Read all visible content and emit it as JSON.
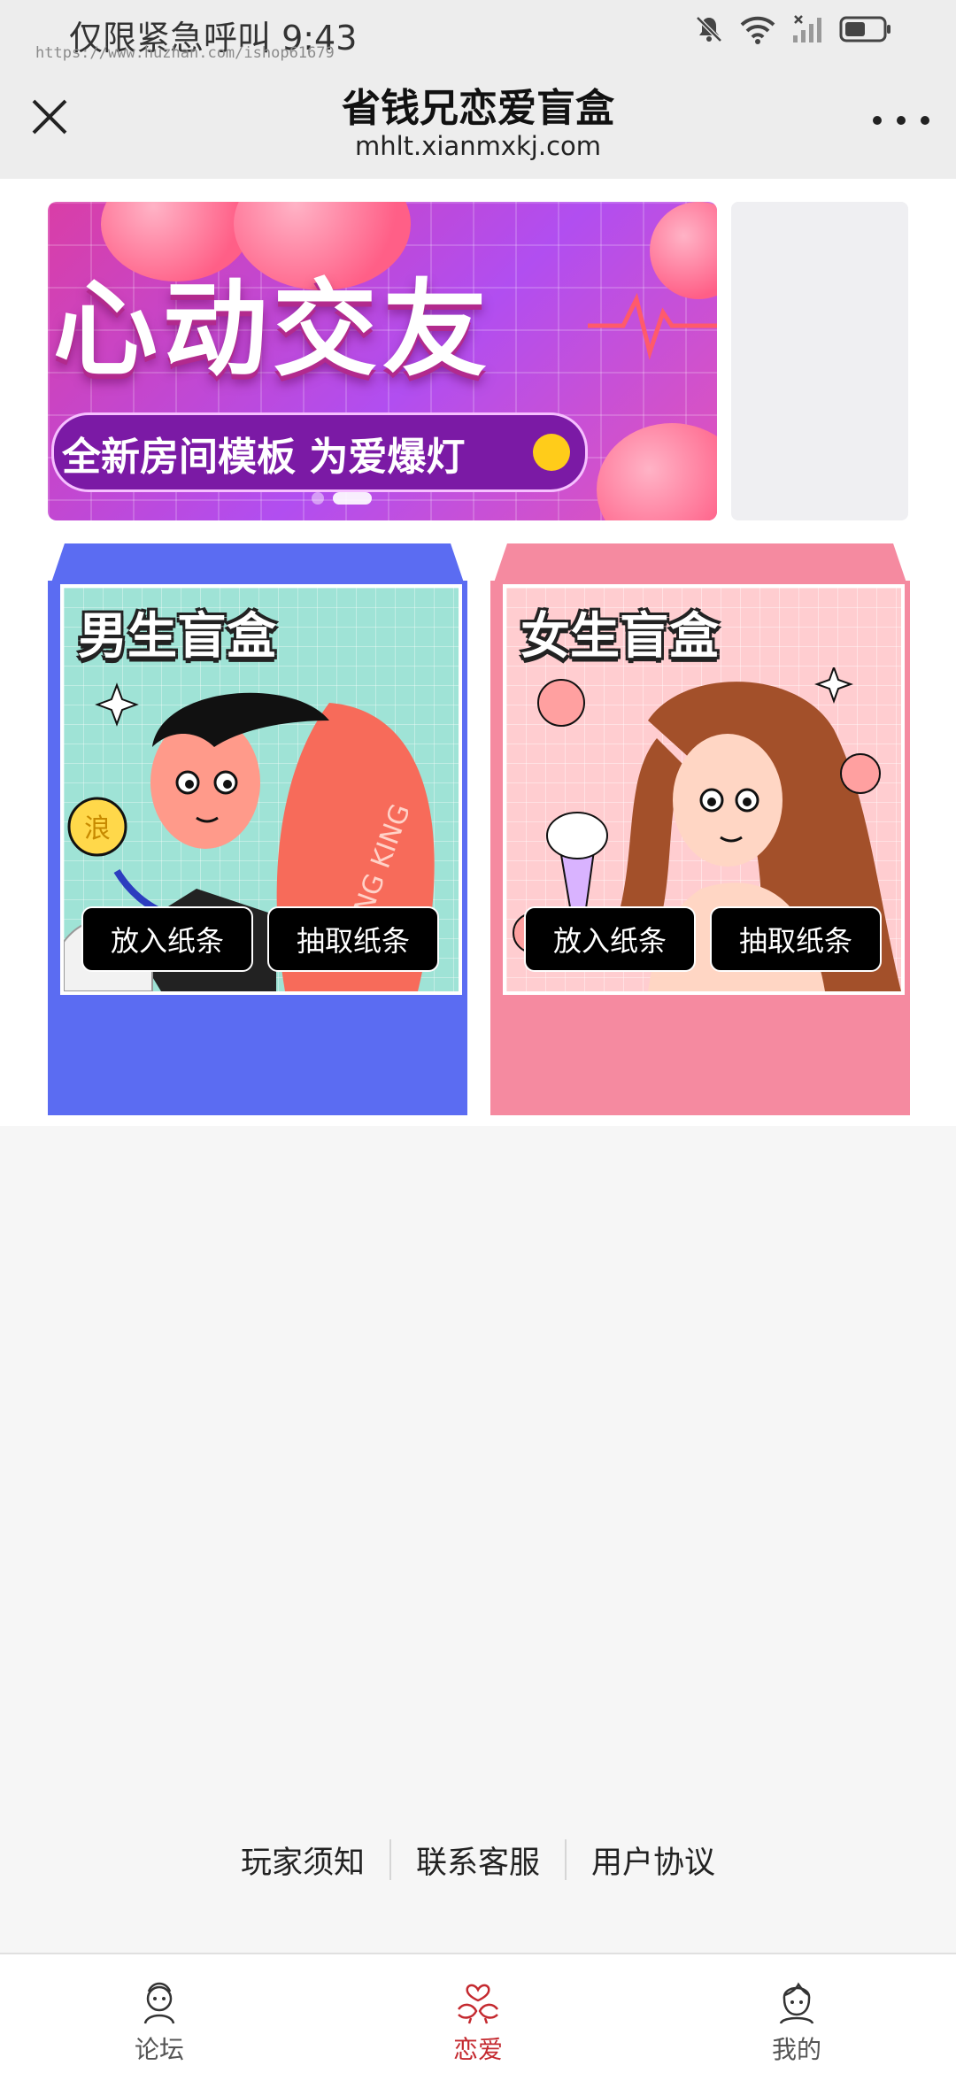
{
  "status_bar": {
    "text": "仅限紧急呼叫 9:43",
    "watermark": "https://www.huzhan.com/ishop61679",
    "icons": [
      "mute-bell-icon",
      "wifi-icon",
      "signal-icon",
      "battery-icon"
    ]
  },
  "header": {
    "title": "省钱兄恋爱盲盒",
    "url": "mhlt.xianmxkj.com",
    "close_icon": "close-icon",
    "more_icon": "more-icon"
  },
  "banner": {
    "headline": "心动交友",
    "subline": "全新房间模板 为爱爆灯",
    "slide_count": 2,
    "active_slide": 2
  },
  "boxes": [
    {
      "title": "男生盲盒",
      "coin_text": "浪",
      "shirt_text": "ANG KING",
      "put_label": "放入纸条",
      "draw_label": "抽取纸条",
      "color": "#5b6cf2",
      "art_bg": "#9fe3d6"
    },
    {
      "title": "女生盲盒",
      "put_label": "放入纸条",
      "draw_label": "抽取纸条",
      "color": "#f58aa0",
      "art_bg": "#ffcdd0"
    }
  ],
  "footer_links": [
    "玩家须知",
    "联系客服",
    "用户协议"
  ],
  "tabs": [
    {
      "label": "论坛",
      "icon": "forum-icon",
      "active": false
    },
    {
      "label": "恋爱",
      "icon": "love-birds-icon",
      "active": true
    },
    {
      "label": "我的",
      "icon": "profile-icon",
      "active": false
    }
  ],
  "colors": {
    "accent": "#c4292f",
    "header_bg": "#ededed",
    "page_bg": "#f6f6f6"
  }
}
